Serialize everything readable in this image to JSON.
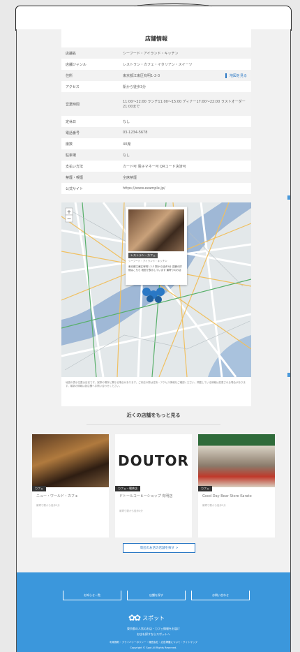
{
  "info": {
    "title": "店舗情報",
    "rows": [
      {
        "key": "店舗名",
        "value": "シーフード・アイランド・キッチン"
      },
      {
        "key": "店舗ジャンル",
        "value": "レストラン・カフェ・イタリアン・スイーツ"
      },
      {
        "key": "住所",
        "value": "東京都江東区有明1-2-3",
        "link": "地図を見る"
      },
      {
        "key": "アクセス",
        "value": "駅から徒歩3分"
      },
      {
        "key": "営業時間",
        "value": "11:00〜22:00 ランチ11:00〜15:00 ディナー17:00〜22:00 ラストオーダー21:00まで",
        "tall": true
      },
      {
        "key": "定休日",
        "value": "なし"
      },
      {
        "key": "電話番号",
        "value": "03-1234-5678"
      },
      {
        "key": "席数",
        "value": "40席"
      },
      {
        "key": "駐車場",
        "value": "なし"
      },
      {
        "key": "支払い方法",
        "value": "カード可 電子マネー可 QRコード決済可"
      },
      {
        "key": "禁煙・喫煙",
        "value": "全席禁煙"
      },
      {
        "key": "公式サイト",
        "value": "https://www.example.jp/",
        "isLink": true
      }
    ]
  },
  "map": {
    "popup": {
      "badge": "レストラン・カフェ",
      "subtitle": "シーフード・アイランド・キッチン",
      "text": "東京都江東区有明1-2-3 駅から徒歩3分 店舗の詳細はこちら 地図で表示しています 最寄りのお店"
    },
    "note": "地図の表示位置は目安です。実際の場所と異なる場合があります。ご来店の際は住所・アクセス情報をご確認ください。掲載している情報は変更される場合があります。最新の情報は各店舗へお問い合わせください。"
  },
  "nearby": {
    "title": "近くの店舗をもっと見る",
    "shops": [
      {
        "badge": "カフェ",
        "name": "ニュー・ワールド・カフェ",
        "sub": "最寄り駅から徒歩2分"
      },
      {
        "badge": "カフェ・喫茶店",
        "name": "ドトールコーヒーショップ 有明店",
        "sub": "最寄り駅から徒歩4分",
        "logo_text": "DOUTOR"
      },
      {
        "badge": "カフェ",
        "name": "Good Day Bear Store Karato",
        "sub": "最寄り駅から徒歩5分"
      }
    ],
    "more_button": "周辺のお店の店舗を探す >"
  },
  "footer": {
    "tabs": [
      "お知らせ一覧",
      "店舗を探す",
      "お問い合わせ"
    ],
    "logo_text": "スポット",
    "lines": [
      "東京都の人気のお店・カフェ情報をお届け",
      "お店を探すならスポットへ",
      "利用規約・プライバシーポリシー・運営会社・広告掲載について・サイトマップ",
      "Copyright © Spot All Rights Reserved."
    ]
  },
  "colors": {
    "accent": "#2a78c5",
    "footer": "#3b97dc"
  }
}
